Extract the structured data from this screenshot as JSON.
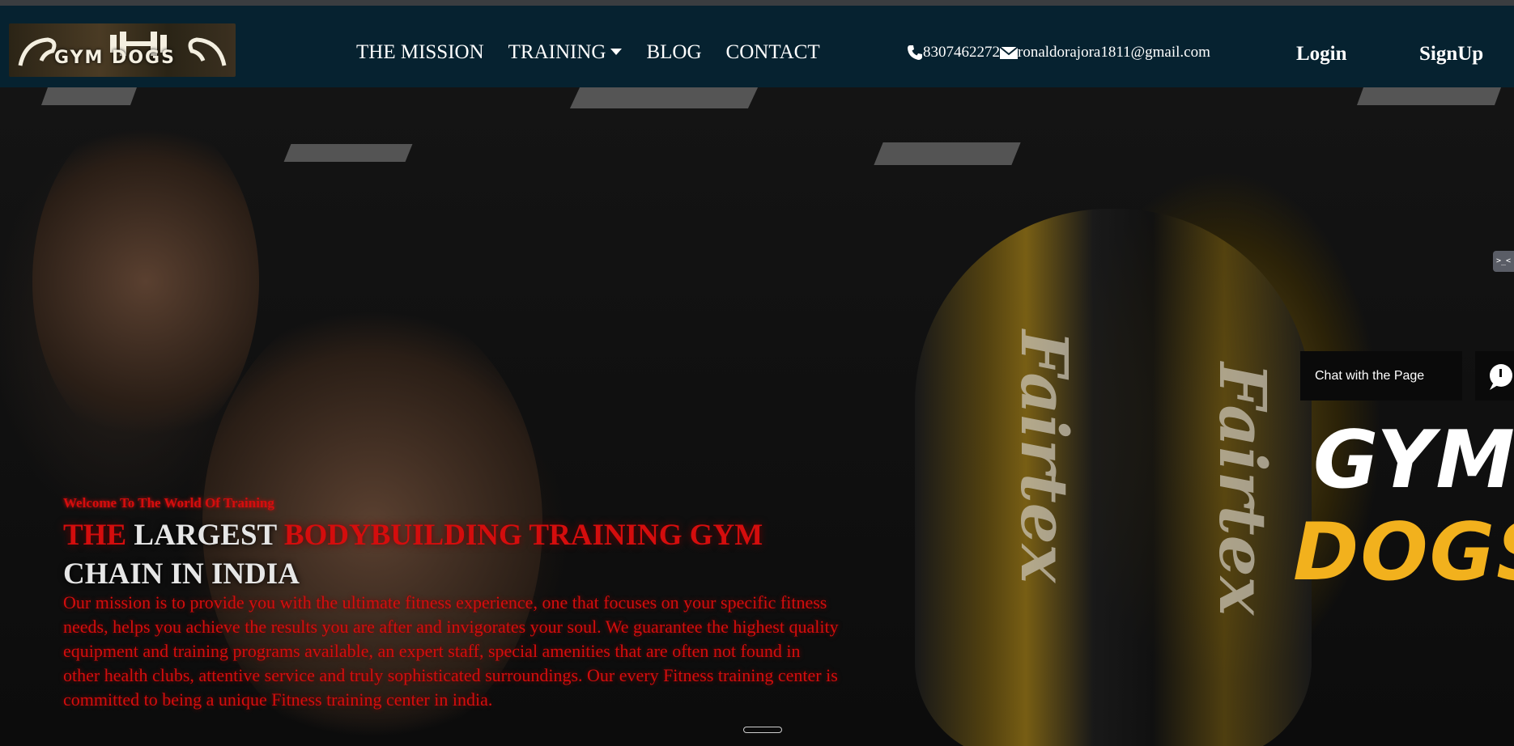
{
  "logo": {
    "text": "GYM DOGS"
  },
  "nav": {
    "items": [
      {
        "label": "THE MISSION"
      },
      {
        "label": "TRAINING"
      },
      {
        "label": "BLOG"
      },
      {
        "label": "CONTACT"
      }
    ]
  },
  "contact": {
    "phone": "8307462272",
    "email": "ronaldorajora1811@gmail.com"
  },
  "auth": {
    "login": "Login",
    "signup": "SignUp"
  },
  "widgets": {
    "top_widget": ">_<",
    "chat_label": "Chat with the Page"
  },
  "hero": {
    "welcome": "Welcome To The World Of Training",
    "headline_1": "THE",
    "headline_2": " LARGEST ",
    "headline_3": "BODYBUILDING TRAINING GYM",
    "headline_4": "CHAIN IN INDIA",
    "mission": "Our mission is to provide you with the ultimate fitness experience, one that focuses on your specific fitness needs, helps you achieve the results you are after and invigorates your soul. We guarantee the highest quality equipment and training programs available, an expert staff, special amenities that are often not found in other health clubs, attentive service and truly sophisticated surroundings. Our every Fitness training center is committed to being a unique Fitness training center in india.",
    "bag_text": "Fairtex",
    "brand_line1": "GYM",
    "brand_line2": "DOGS"
  },
  "colors": {
    "navbar": "#062230",
    "accent_red": "#d40d0d",
    "brand_yellow": "#f2b11d"
  }
}
